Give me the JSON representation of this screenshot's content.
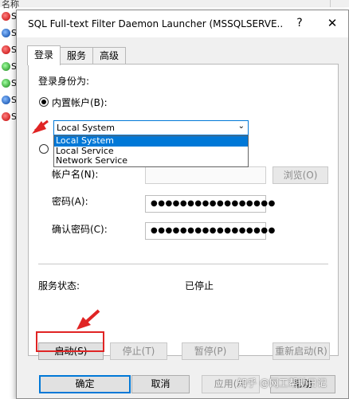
{
  "background": {
    "header_label": "名称",
    "items": [
      {
        "label": "SG",
        "icon": "red"
      },
      {
        "label": "SG",
        "icon": "blue"
      },
      {
        "label": "SG",
        "icon": "red"
      },
      {
        "label": "SG",
        "icon": "green"
      },
      {
        "label": "SG",
        "icon": "green"
      },
      {
        "label": "SG",
        "icon": "blue"
      },
      {
        "label": "SG",
        "icon": "red"
      }
    ]
  },
  "dialog": {
    "title": "SQL Full-text Filter Daemon Launcher (MSSQLSERVE...",
    "help_glyph": "?",
    "close_glyph": "✕",
    "tabs": [
      "登录",
      "服务",
      "高级"
    ],
    "logon_as_label": "登录身份为:",
    "builtin_account_label": "内置帐户(B):",
    "account_combo": {
      "value": "Local System",
      "options": [
        "Local System",
        "Local Service",
        "Network Service"
      ],
      "selected_index": 0
    },
    "account_name_label": "帐户名(N):",
    "browse_label": "浏览(O)",
    "password_label": "密码(A):",
    "password_mask": "●●●●●●●●●●●●●●●●●",
    "confirm_password_label": "确认密码(C):",
    "confirm_password_mask": "●●●●●●●●●●●●●●●●●",
    "service_status_label": "服务状态:",
    "service_status_value": "已停止",
    "buttons": {
      "start": "启动(S)",
      "stop": "停止(T)",
      "pause": "暂停(P)",
      "restart": "重新启动(R)"
    },
    "footer": {
      "ok": "确定",
      "cancel": "取消",
      "apply": "应用(A)",
      "help": "帮助"
    }
  },
  "watermark": "知乎 @网工帮助日记",
  "colors": {
    "accent": "#0078d7",
    "highlight_red": "#e02424"
  }
}
